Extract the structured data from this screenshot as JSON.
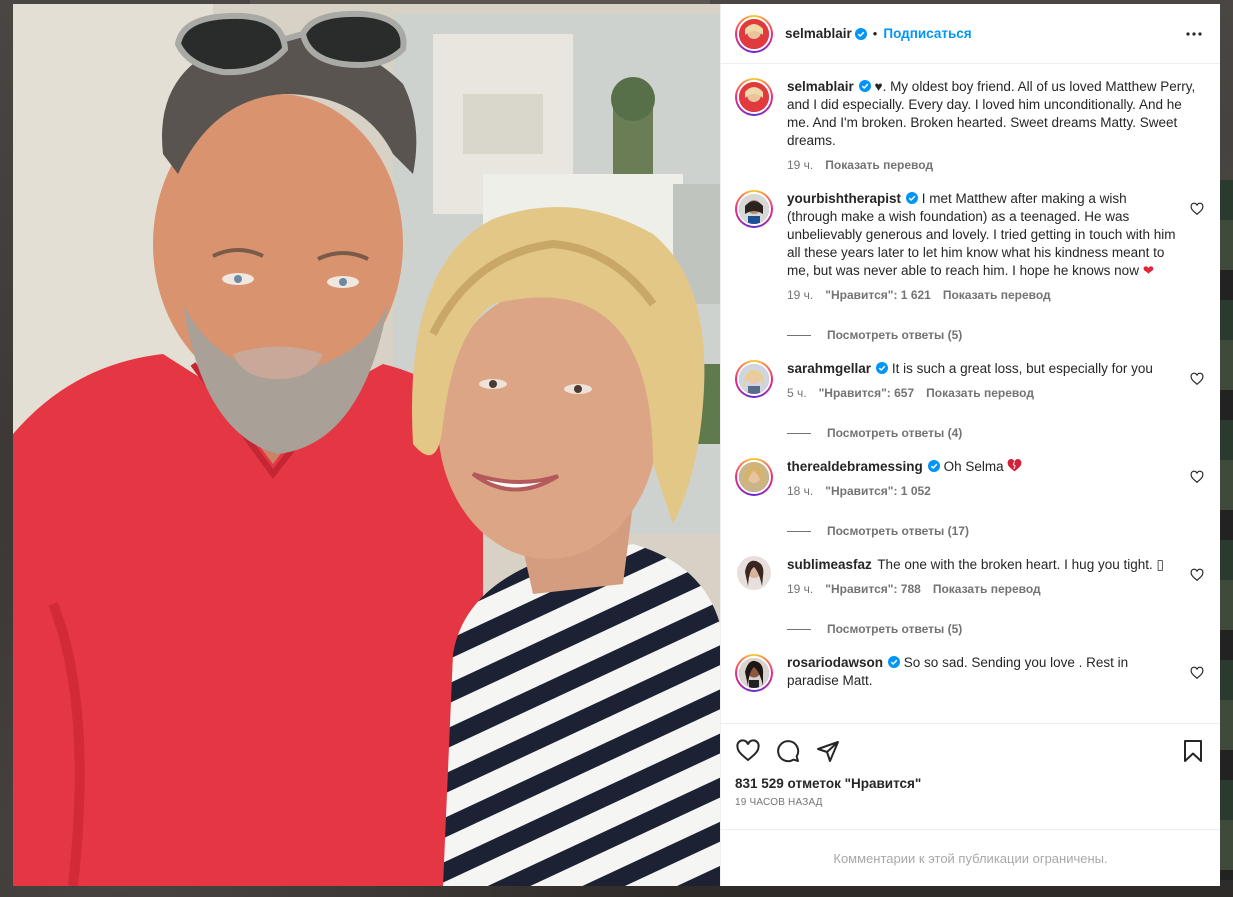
{
  "header": {
    "username": "selmablair",
    "separator": "•",
    "follow_label": "Подписаться"
  },
  "caption": {
    "username": "selmablair",
    "text": " ♥. My oldest boy friend. All of us loved Matthew Perry, and I did especially. Every day. I loved him unconditionally. And he me. And I'm broken. Broken hearted. Sweet dreams Matty. Sweet dreams.",
    "time": "19 ч.",
    "translate": "Показать перевод"
  },
  "comments": [
    {
      "username": "yourbishtherapist",
      "text": "I met Matthew after making a wish (through make a wish foundation) as a teenaged. He was unbelievably generous and lovely. I tried getting in touch with him all these years later to let him know what his kindness meant to me, but was never able to reach him. I hope he knows now",
      "emoji": "❤",
      "time": "19 ч.",
      "likes": "\"Нравится\": 1 621",
      "translate": "Показать перевод",
      "replies": "Посмотреть ответы (5)"
    },
    {
      "username": "sarahmgellar",
      "text": "It is such a great loss, but especially for you",
      "emoji": "",
      "time": "5 ч.",
      "likes": "\"Нравится\": 657",
      "translate": "Показать перевод",
      "replies": "Посмотреть ответы (4)"
    },
    {
      "username": "therealdebramessing",
      "text": "Oh Selma",
      "emoji": "❤",
      "time": "18 ч.",
      "likes": "\"Нравится\": 1 052",
      "translate": "",
      "replies": "Посмотреть ответы (17)"
    },
    {
      "username": "sublimeasfaz",
      "text": "The one with the broken heart. I hug you tight. ▯",
      "emoji": "",
      "time": "19 ч.",
      "likes": "\"Нравится\": 788",
      "translate": "Показать перевод",
      "replies": "Посмотреть ответы (5)"
    },
    {
      "username": "rosariodawson",
      "text": "So so sad. Sending you love . Rest in paradise Matt.",
      "emoji": "",
      "time": "",
      "likes": "",
      "translate": "",
      "replies": ""
    }
  ],
  "footer": {
    "likes_text": "831 529 отметок \"Нравится\"",
    "timestamp": "19 часов назад",
    "restricted": "Комментарии к этой публикации ограничены."
  },
  "icons": {
    "heart": "heart-icon",
    "comment": "comment-icon",
    "share": "share-icon",
    "save": "bookmark-icon",
    "more": "more-icon",
    "verified": "verified-badge-icon"
  },
  "colors": {
    "accent": "#0095f6",
    "verified": "#0095f6",
    "emoji_heart": "#e0263a",
    "muted_text": "#737373"
  }
}
